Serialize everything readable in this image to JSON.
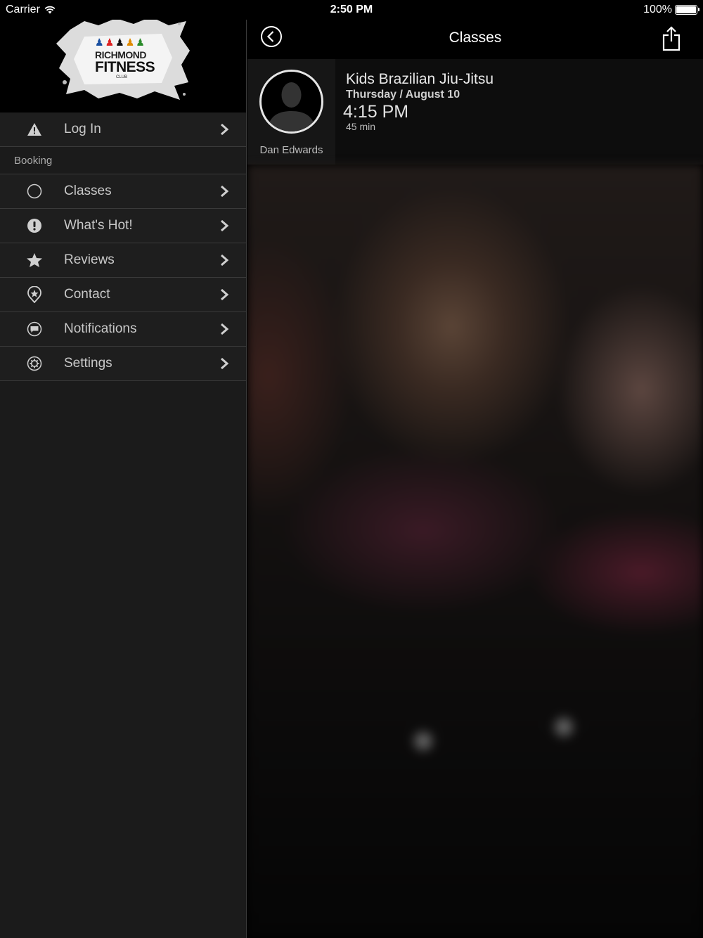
{
  "status_bar": {
    "carrier": "Carrier",
    "time": "2:50 PM",
    "battery": "100%"
  },
  "sidebar": {
    "logo": {
      "line1": "RICHMOND",
      "line2": "FITNESS",
      "line3": "CLUB"
    },
    "login": {
      "label": "Log In",
      "icon": "warning-icon"
    },
    "section_label": "Booking",
    "items": [
      {
        "label": "Classes",
        "icon": "circle-icon"
      },
      {
        "label": "What's Hot!",
        "icon": "exclamation-icon"
      },
      {
        "label": "Reviews",
        "icon": "star-icon"
      },
      {
        "label": "Contact",
        "icon": "location-pin-icon"
      },
      {
        "label": "Notifications",
        "icon": "chat-bubble-icon"
      },
      {
        "label": "Settings",
        "icon": "gear-icon"
      }
    ]
  },
  "main": {
    "nav_title": "Classes",
    "class": {
      "title": "Kids Brazilian Jiu-Jitsu",
      "date": "Thursday / August 10",
      "time": "4:15 PM",
      "duration": "45 min",
      "instructor": "Dan Edwards"
    }
  },
  "colors": {
    "sidebar_bg": "#1b1b1b",
    "divider": "#3a3a3a",
    "menu_text": "#c8c8c8"
  }
}
